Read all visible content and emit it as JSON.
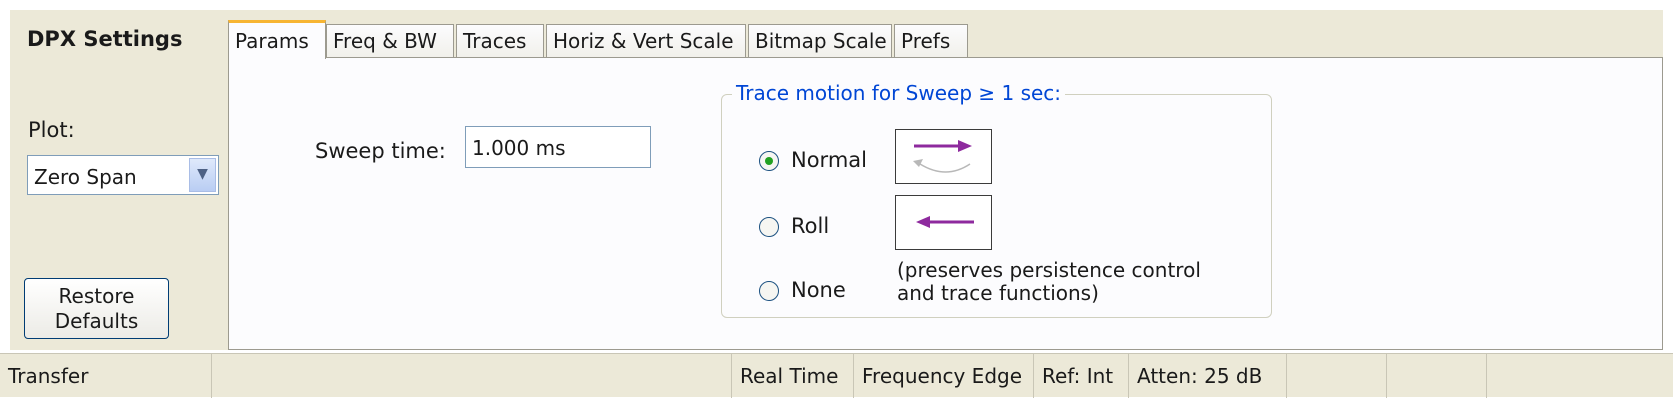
{
  "dpx_settings": {
    "title": "DPX Settings",
    "plot_label": "Plot:",
    "plot_value": "Zero Span",
    "restore_line1": "Restore",
    "restore_line2": "Defaults"
  },
  "tabs": [
    {
      "label": "Params",
      "active": true
    },
    {
      "label": "Freq & BW",
      "active": false
    },
    {
      "label": "Traces",
      "active": false
    },
    {
      "label": "Horiz & Vert Scale",
      "active": false
    },
    {
      "label": "Bitmap Scale",
      "active": false
    },
    {
      "label": "Prefs",
      "active": false
    }
  ],
  "params": {
    "sweep_label": "Sweep time:",
    "sweep_value": "1.000 ms",
    "trace_motion": {
      "group_label": "Trace motion for Sweep ≥ 1 sec:",
      "options": [
        {
          "label": "Normal",
          "selected": true,
          "icon": "sweep-wrap-icon"
        },
        {
          "label": "Roll",
          "selected": false,
          "icon": "roll-left-arrow-icon"
        },
        {
          "label": "None",
          "selected": false
        }
      ],
      "note_line1": "(preserves persistence control",
      "note_line2": "and trace functions)"
    }
  },
  "status_bar": {
    "transfer": "Transfer",
    "real_time": "Real Time",
    "frequency_edge": "Frequency Edge",
    "ref": "Ref: Int",
    "atten": "Atten: 25 dB"
  },
  "colors": {
    "panel_bg": "#ece9d8",
    "content_bg": "#fcfcfe",
    "active_tab_accent": "#f7b533",
    "group_label": "#0046d5",
    "arrow_purple": "#8e2a9e",
    "radio_selected": "#21a121"
  }
}
